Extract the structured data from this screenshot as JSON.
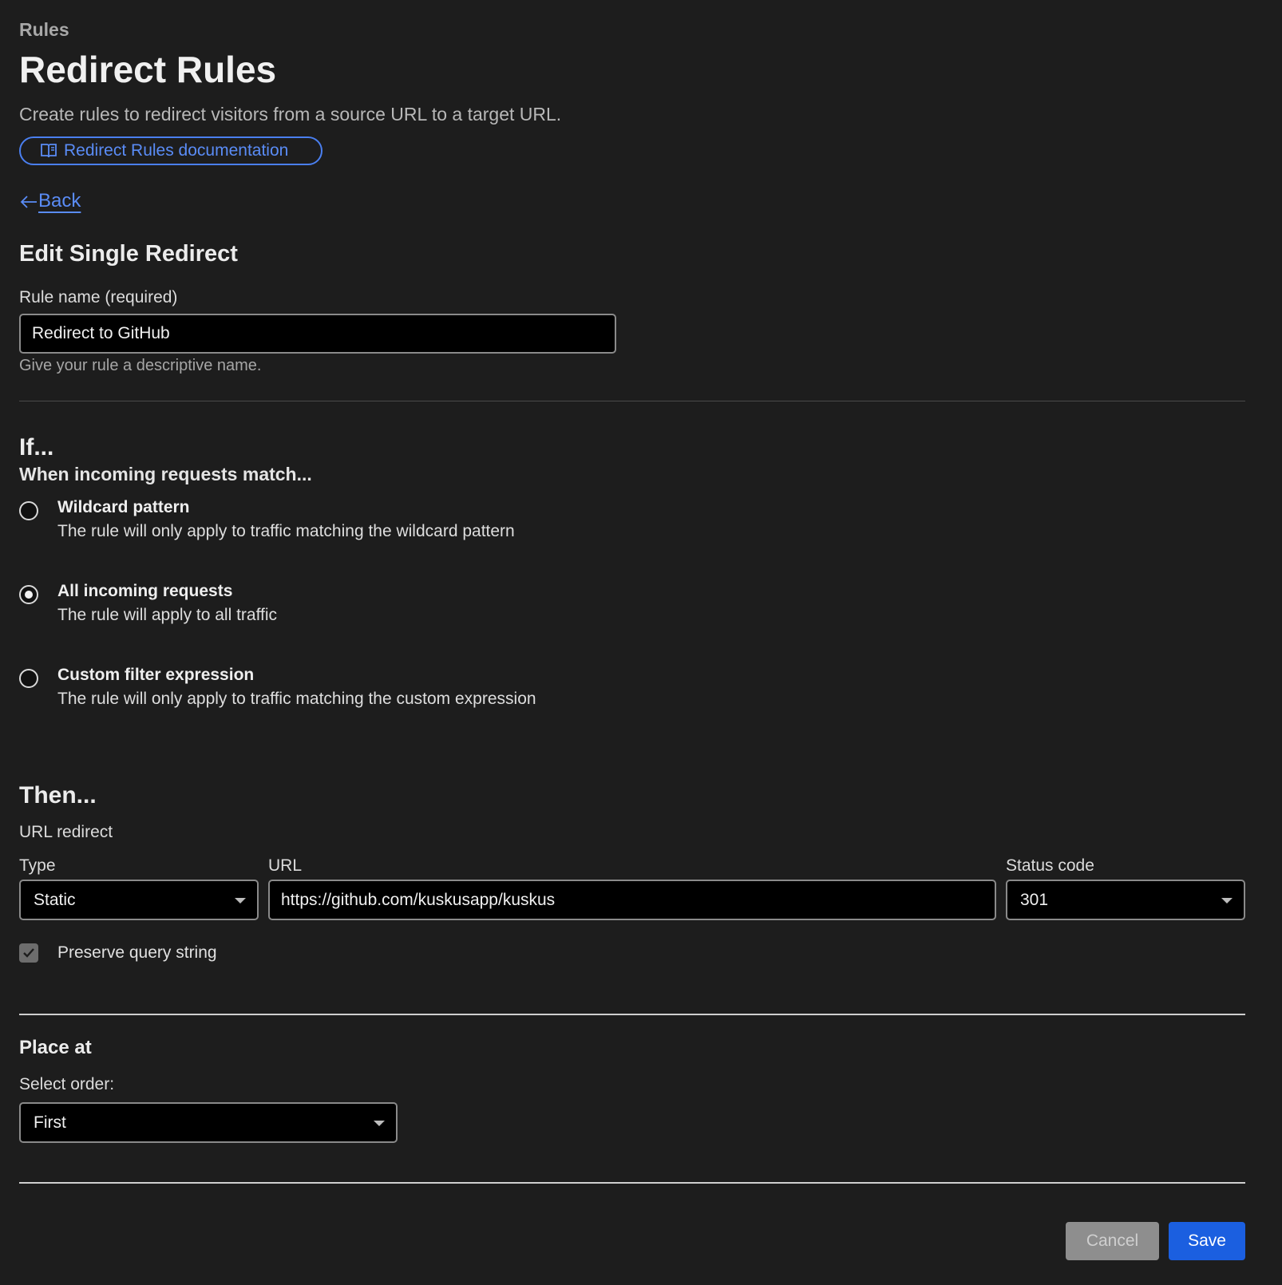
{
  "header": {
    "breadcrumb": "Rules",
    "title": "Redirect Rules",
    "subtitle": "Create rules to redirect visitors from a source URL to a target URL.",
    "doc_link": "Redirect Rules documentation",
    "back": "Back"
  },
  "form": {
    "section_title": "Edit Single Redirect",
    "rule_name": {
      "label": "Rule name (required)",
      "value": "Redirect to GitHub",
      "help": "Give your rule a descriptive name."
    }
  },
  "if_section": {
    "heading": "If...",
    "subheading": "When incoming requests match...",
    "options": [
      {
        "title": "Wildcard pattern",
        "description": "The rule will only apply to traffic matching the wildcard pattern",
        "checked": false
      },
      {
        "title": "All incoming requests",
        "description": "The rule will apply to all traffic",
        "checked": true
      },
      {
        "title": "Custom filter expression",
        "description": "The rule will only apply to traffic matching the custom expression",
        "checked": false
      }
    ]
  },
  "then_section": {
    "heading": "Then...",
    "action_label": "URL redirect",
    "type": {
      "label": "Type",
      "value": "Static"
    },
    "url": {
      "label": "URL",
      "value": "https://github.com/kuskusapp/kuskus"
    },
    "status_code": {
      "label": "Status code",
      "value": "301"
    },
    "preserve_query": {
      "label": "Preserve query string",
      "checked": true
    }
  },
  "place_at": {
    "heading": "Place at",
    "order_label": "Select order:",
    "order_value": "First"
  },
  "actions": {
    "cancel": "Cancel",
    "save": "Save"
  },
  "colors": {
    "background": "#1d1d1d",
    "link": "#5a8cf6",
    "primary_button": "#1b5fe0",
    "cancel_button": "#8e8e8e"
  }
}
